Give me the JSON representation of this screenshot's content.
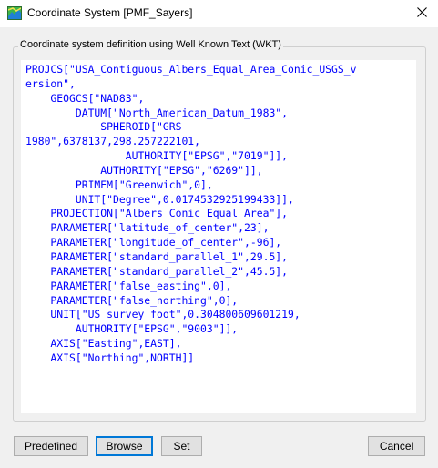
{
  "window": {
    "title": "Coordinate System [PMF_Sayers]",
    "icon": "coordinate-system-app-icon",
    "close_icon": "close-icon"
  },
  "group": {
    "legend": "Coordinate system definition using Well Known Text (WKT)"
  },
  "wkt_lines": [
    "PROJCS[\"USA_Contiguous_Albers_Equal_Area_Conic_USGS_v",
    "ersion\",",
    "    GEOGCS[\"NAD83\",",
    "        DATUM[\"North_American_Datum_1983\",",
    "            SPHEROID[\"GRS",
    "1980\",6378137,298.257222101,",
    "                AUTHORITY[\"EPSG\",\"7019\"]],",
    "            AUTHORITY[\"EPSG\",\"6269\"]],",
    "        PRIMEM[\"Greenwich\",0],",
    "        UNIT[\"Degree\",0.0174532925199433]],",
    "    PROJECTION[\"Albers_Conic_Equal_Area\"],",
    "    PARAMETER[\"latitude_of_center\",23],",
    "    PARAMETER[\"longitude_of_center\",-96],",
    "    PARAMETER[\"standard_parallel_1\",29.5],",
    "    PARAMETER[\"standard_parallel_2\",45.5],",
    "    PARAMETER[\"false_easting\",0],",
    "    PARAMETER[\"false_northing\",0],",
    "    UNIT[\"US survey foot\",0.304800609601219,",
    "        AUTHORITY[\"EPSG\",\"9003\"]],",
    "    AXIS[\"Easting\",EAST],",
    "    AXIS[\"Northing\",NORTH]]"
  ],
  "buttons": {
    "predefined": "Predefined",
    "browse": "Browse",
    "set": "Set",
    "cancel": "Cancel"
  },
  "colors": {
    "wkt_text": "#0000ff",
    "focus_border": "#0078d7"
  }
}
